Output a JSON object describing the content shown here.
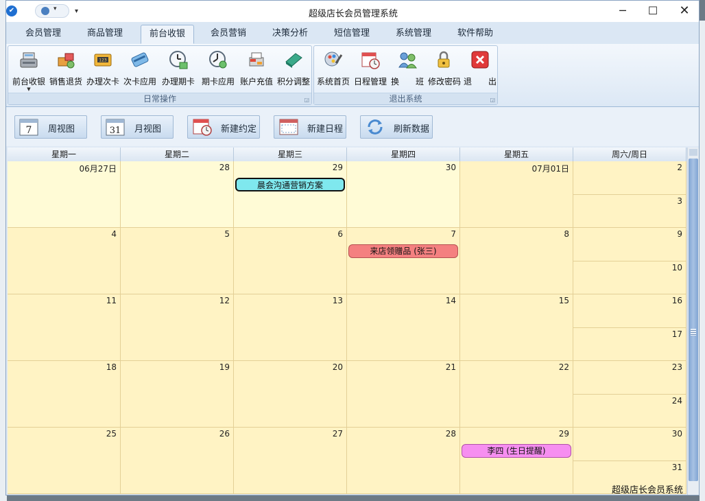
{
  "window": {
    "title": "超级店长会员管理系统"
  },
  "ribbon_tabs": [
    {
      "label": "会员管理"
    },
    {
      "label": "商品管理"
    },
    {
      "label": "前台收银"
    },
    {
      "label": "会员营销"
    },
    {
      "label": "决策分析"
    },
    {
      "label": "短信管理"
    },
    {
      "label": "系统管理"
    },
    {
      "label": "软件帮助"
    }
  ],
  "active_tab": "前台收银",
  "ribbon_groups": {
    "daily": {
      "label": "日常操作",
      "buttons": [
        {
          "label": "前台收银",
          "icon": "cash-register-icon"
        },
        {
          "label": "销售退货",
          "icon": "return-goods-icon"
        },
        {
          "label": "办理次卡",
          "icon": "times-card-icon"
        },
        {
          "label": "次卡应用",
          "icon": "card-use-icon"
        },
        {
          "label": "办理期卡",
          "icon": "period-card-icon"
        },
        {
          "label": "期卡应用",
          "icon": "period-card-use-icon"
        },
        {
          "label": "账户充值",
          "icon": "recharge-icon"
        },
        {
          "label": "积分调整",
          "icon": "points-adjust-icon"
        }
      ]
    },
    "exit": {
      "label": "退出系统",
      "buttons": [
        {
          "label": "系统首页",
          "icon": "home-page-icon"
        },
        {
          "label": "日程管理",
          "icon": "schedule-icon"
        },
        {
          "label": "换　　班",
          "icon": "shift-change-icon"
        },
        {
          "label": "修改密码",
          "icon": "change-password-icon"
        },
        {
          "label": "退　　出",
          "icon": "exit-icon"
        }
      ]
    }
  },
  "toolbar": [
    {
      "label": "周视图",
      "icon": "week-view-icon",
      "badge": "7"
    },
    {
      "label": "月视图",
      "icon": "month-view-icon",
      "badge": "31"
    },
    {
      "label": "新建约定",
      "icon": "new-appointment-icon"
    },
    {
      "label": "新建日程",
      "icon": "new-schedule-icon"
    },
    {
      "label": "刷新数据",
      "icon": "refresh-icon"
    }
  ],
  "calendar": {
    "headers": [
      "星期一",
      "星期二",
      "星期三",
      "星期四",
      "星期五",
      "周六/周日"
    ],
    "weeks": [
      {
        "days": [
          "06月27日",
          "28",
          "29",
          "30",
          "07月01日"
        ],
        "sat": "2",
        "sun": "3",
        "current_month": [
          false,
          false,
          false,
          false,
          true,
          true
        ]
      },
      {
        "days": [
          "4",
          "5",
          "6",
          "7",
          "8"
        ],
        "sat": "9",
        "sun": "10"
      },
      {
        "days": [
          "11",
          "12",
          "13",
          "14",
          "15"
        ],
        "sat": "16",
        "sun": "17"
      },
      {
        "days": [
          "18",
          "19",
          "20",
          "21",
          "22"
        ],
        "sat": "23",
        "sun": "24"
      },
      {
        "days": [
          "25",
          "26",
          "27",
          "28",
          "29"
        ],
        "sat": "30",
        "sun": "31"
      }
    ],
    "events": [
      {
        "title": "晨会沟通营销方案",
        "week": 0,
        "day": 2,
        "color": "#7fe8ee",
        "border": "#111111"
      },
      {
        "title": "来店领赠品 (张三)",
        "week": 1,
        "day": 3,
        "color": "#f48080",
        "border": "#b35050"
      },
      {
        "title": "李四 (生日提醒)",
        "week": 4,
        "day": 4,
        "color": "#f68ef0",
        "border": "#b050a8"
      }
    ],
    "colors": {
      "current_month": "#fff3c4",
      "other_month": "#fffbd6",
      "grid": "#e3cf96"
    }
  },
  "footer": {
    "brand": "超级店长会员系统"
  }
}
